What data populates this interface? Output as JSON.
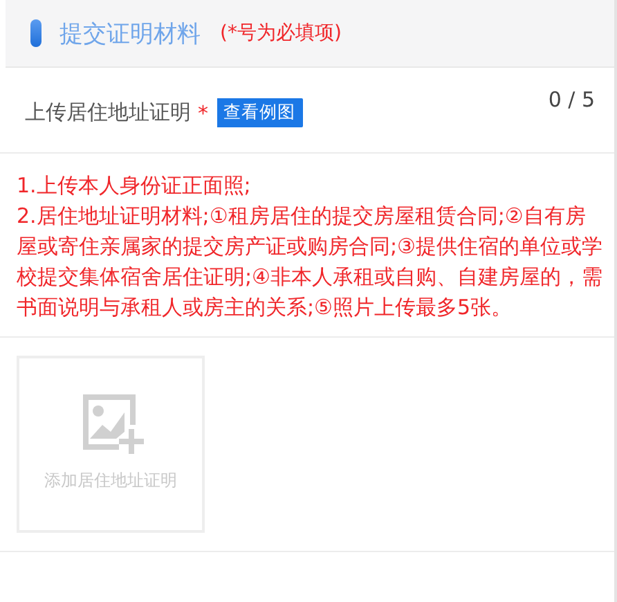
{
  "section": {
    "title": "提交证明材料",
    "required_note": "(*号为必填项)"
  },
  "upload": {
    "label": "上传居住地址证明",
    "required_mark": "*",
    "example_button": "查看例图",
    "count": "0 / 5",
    "instructions": [
      "1.上传本人身份证正面照;",
      "2.居住地址证明材料;①租房居住的提交房屋租赁合同;②自有房屋或寄住亲属家的提交房产证或购房合同;③提供住宿的单位或学校提交集体宿舍居住证明;④非本人承租或自购、自建房屋的，需书面说明与承租人或房主的关系;⑤照片上传最多5张。"
    ],
    "add_tile": "添加居住地址证明"
  }
}
